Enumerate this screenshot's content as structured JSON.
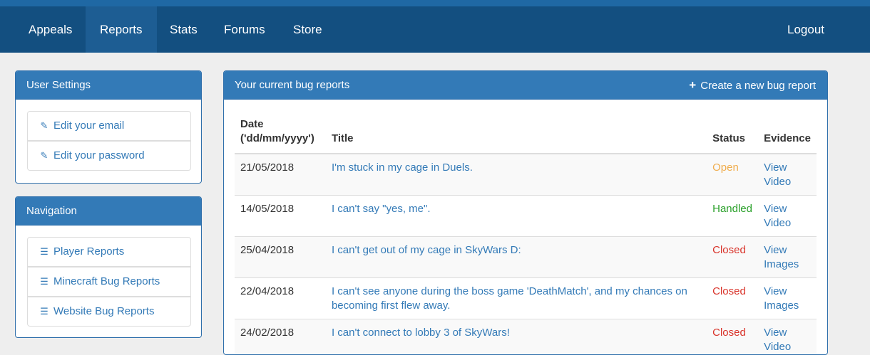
{
  "nav": {
    "items": [
      {
        "label": "Appeals"
      },
      {
        "label": "Reports"
      },
      {
        "label": "Stats"
      },
      {
        "label": "Forums"
      },
      {
        "label": "Store"
      }
    ],
    "active": "Reports",
    "logout": "Logout"
  },
  "user_settings": {
    "title": "User Settings",
    "items": [
      {
        "label": "Edit your email",
        "icon": "pencil-icon"
      },
      {
        "label": "Edit your password",
        "icon": "pencil-icon"
      }
    ]
  },
  "navigation": {
    "title": "Navigation",
    "items": [
      {
        "label": "Player Reports",
        "icon": "list-icon"
      },
      {
        "label": "Minecraft Bug Reports",
        "icon": "list-icon"
      },
      {
        "label": "Website Bug Reports",
        "icon": "list-icon"
      }
    ]
  },
  "reports": {
    "title": "Your current bug reports",
    "create_label": "Create a new bug report",
    "columns": {
      "date_line1": "Date",
      "date_line2": "('dd/mm/yyyy')",
      "title": "Title",
      "status": "Status",
      "evidence": "Evidence"
    },
    "rows": [
      {
        "date": "21/05/2018",
        "title": "I'm stuck in my cage in Duels.",
        "status": "Open",
        "evidence_1": "View",
        "evidence_2": "Video"
      },
      {
        "date": "14/05/2018",
        "title": "I can't say \"yes, me\".",
        "status": "Handled",
        "evidence_1": "View",
        "evidence_2": "Video"
      },
      {
        "date": "25/04/2018",
        "title": "I can't get out of my cage in SkyWars D:",
        "status": "Closed",
        "evidence_1": "View",
        "evidence_2": "Images"
      },
      {
        "date": "22/04/2018",
        "title": "I can't see anyone during the boss game 'DeathMatch', and my chances on becoming first flew away.",
        "status": "Closed",
        "evidence_1": "View",
        "evidence_2": "Images"
      },
      {
        "date": "24/02/2018",
        "title": "I can't connect to lobby 3 of SkyWars!",
        "status": "Closed",
        "evidence_1": "View",
        "evidence_2": "Video"
      }
    ]
  },
  "colors": {
    "navbar": "#134f80",
    "panel_header": "#337ab7",
    "link": "#337ab7",
    "status_open": "#f0ad4e",
    "status_handled": "#2aa02a",
    "status_closed": "#d9342b"
  }
}
